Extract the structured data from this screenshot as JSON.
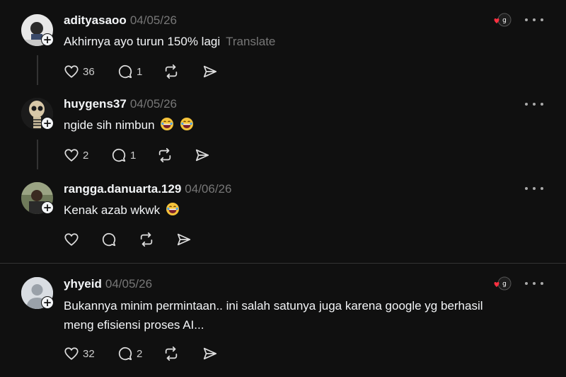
{
  "posts": [
    {
      "username": "adityasaoo",
      "date": "04/05/26",
      "text": "Akhirnya ayo turun 150% lagi",
      "translate_label": "Translate",
      "likes": "36",
      "replies": "1"
    },
    {
      "username": "huygens37",
      "date": "04/05/26",
      "text": "ngide sih nimbun",
      "likes": "2",
      "replies": "1"
    },
    {
      "username": "rangga.danuarta.129",
      "date": "04/06/26",
      "text": "Kenak azab wkwk"
    },
    {
      "username": "yhyeid",
      "date": "04/05/26",
      "text_line1": "Bukannya minim permintaan.. ini salah satunya juga karena google yg berhasil",
      "text_line2": "meng efisiensi proses AI...",
      "likes": "32",
      "replies": "2"
    }
  ],
  "colors": {
    "background": "#101010",
    "text": "#f3f5f7",
    "muted": "#777777",
    "badge_heart": "#ff3040"
  },
  "icons": [
    "heart-icon",
    "comment-icon",
    "repost-icon",
    "share-icon",
    "more-icon",
    "plus-icon",
    "grinning-emoji"
  ]
}
